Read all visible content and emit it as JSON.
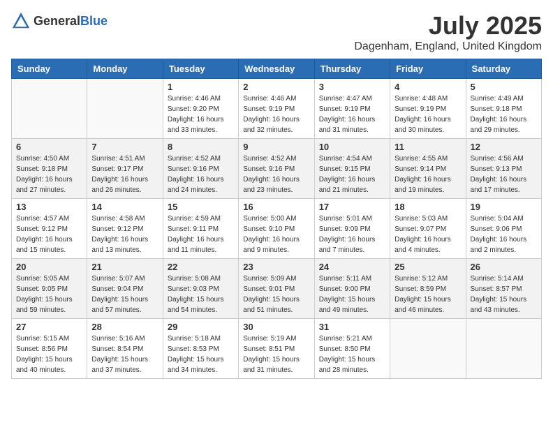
{
  "header": {
    "logo_general": "General",
    "logo_blue": "Blue",
    "month": "July 2025",
    "location": "Dagenham, England, United Kingdom"
  },
  "days_of_week": [
    "Sunday",
    "Monday",
    "Tuesday",
    "Wednesday",
    "Thursday",
    "Friday",
    "Saturday"
  ],
  "weeks": [
    {
      "shaded": false,
      "days": [
        {
          "num": "",
          "sunrise": "",
          "sunset": "",
          "daylight": ""
        },
        {
          "num": "",
          "sunrise": "",
          "sunset": "",
          "daylight": ""
        },
        {
          "num": "1",
          "sunrise": "Sunrise: 4:46 AM",
          "sunset": "Sunset: 9:20 PM",
          "daylight": "Daylight: 16 hours and 33 minutes."
        },
        {
          "num": "2",
          "sunrise": "Sunrise: 4:46 AM",
          "sunset": "Sunset: 9:19 PM",
          "daylight": "Daylight: 16 hours and 32 minutes."
        },
        {
          "num": "3",
          "sunrise": "Sunrise: 4:47 AM",
          "sunset": "Sunset: 9:19 PM",
          "daylight": "Daylight: 16 hours and 31 minutes."
        },
        {
          "num": "4",
          "sunrise": "Sunrise: 4:48 AM",
          "sunset": "Sunset: 9:19 PM",
          "daylight": "Daylight: 16 hours and 30 minutes."
        },
        {
          "num": "5",
          "sunrise": "Sunrise: 4:49 AM",
          "sunset": "Sunset: 9:18 PM",
          "daylight": "Daylight: 16 hours and 29 minutes."
        }
      ]
    },
    {
      "shaded": true,
      "days": [
        {
          "num": "6",
          "sunrise": "Sunrise: 4:50 AM",
          "sunset": "Sunset: 9:18 PM",
          "daylight": "Daylight: 16 hours and 27 minutes."
        },
        {
          "num": "7",
          "sunrise": "Sunrise: 4:51 AM",
          "sunset": "Sunset: 9:17 PM",
          "daylight": "Daylight: 16 hours and 26 minutes."
        },
        {
          "num": "8",
          "sunrise": "Sunrise: 4:52 AM",
          "sunset": "Sunset: 9:16 PM",
          "daylight": "Daylight: 16 hours and 24 minutes."
        },
        {
          "num": "9",
          "sunrise": "Sunrise: 4:52 AM",
          "sunset": "Sunset: 9:16 PM",
          "daylight": "Daylight: 16 hours and 23 minutes."
        },
        {
          "num": "10",
          "sunrise": "Sunrise: 4:54 AM",
          "sunset": "Sunset: 9:15 PM",
          "daylight": "Daylight: 16 hours and 21 minutes."
        },
        {
          "num": "11",
          "sunrise": "Sunrise: 4:55 AM",
          "sunset": "Sunset: 9:14 PM",
          "daylight": "Daylight: 16 hours and 19 minutes."
        },
        {
          "num": "12",
          "sunrise": "Sunrise: 4:56 AM",
          "sunset": "Sunset: 9:13 PM",
          "daylight": "Daylight: 16 hours and 17 minutes."
        }
      ]
    },
    {
      "shaded": false,
      "days": [
        {
          "num": "13",
          "sunrise": "Sunrise: 4:57 AM",
          "sunset": "Sunset: 9:12 PM",
          "daylight": "Daylight: 16 hours and 15 minutes."
        },
        {
          "num": "14",
          "sunrise": "Sunrise: 4:58 AM",
          "sunset": "Sunset: 9:12 PM",
          "daylight": "Daylight: 16 hours and 13 minutes."
        },
        {
          "num": "15",
          "sunrise": "Sunrise: 4:59 AM",
          "sunset": "Sunset: 9:11 PM",
          "daylight": "Daylight: 16 hours and 11 minutes."
        },
        {
          "num": "16",
          "sunrise": "Sunrise: 5:00 AM",
          "sunset": "Sunset: 9:10 PM",
          "daylight": "Daylight: 16 hours and 9 minutes."
        },
        {
          "num": "17",
          "sunrise": "Sunrise: 5:01 AM",
          "sunset": "Sunset: 9:09 PM",
          "daylight": "Daylight: 16 hours and 7 minutes."
        },
        {
          "num": "18",
          "sunrise": "Sunrise: 5:03 AM",
          "sunset": "Sunset: 9:07 PM",
          "daylight": "Daylight: 16 hours and 4 minutes."
        },
        {
          "num": "19",
          "sunrise": "Sunrise: 5:04 AM",
          "sunset": "Sunset: 9:06 PM",
          "daylight": "Daylight: 16 hours and 2 minutes."
        }
      ]
    },
    {
      "shaded": true,
      "days": [
        {
          "num": "20",
          "sunrise": "Sunrise: 5:05 AM",
          "sunset": "Sunset: 9:05 PM",
          "daylight": "Daylight: 15 hours and 59 minutes."
        },
        {
          "num": "21",
          "sunrise": "Sunrise: 5:07 AM",
          "sunset": "Sunset: 9:04 PM",
          "daylight": "Daylight: 15 hours and 57 minutes."
        },
        {
          "num": "22",
          "sunrise": "Sunrise: 5:08 AM",
          "sunset": "Sunset: 9:03 PM",
          "daylight": "Daylight: 15 hours and 54 minutes."
        },
        {
          "num": "23",
          "sunrise": "Sunrise: 5:09 AM",
          "sunset": "Sunset: 9:01 PM",
          "daylight": "Daylight: 15 hours and 51 minutes."
        },
        {
          "num": "24",
          "sunrise": "Sunrise: 5:11 AM",
          "sunset": "Sunset: 9:00 PM",
          "daylight": "Daylight: 15 hours and 49 minutes."
        },
        {
          "num": "25",
          "sunrise": "Sunrise: 5:12 AM",
          "sunset": "Sunset: 8:59 PM",
          "daylight": "Daylight: 15 hours and 46 minutes."
        },
        {
          "num": "26",
          "sunrise": "Sunrise: 5:14 AM",
          "sunset": "Sunset: 8:57 PM",
          "daylight": "Daylight: 15 hours and 43 minutes."
        }
      ]
    },
    {
      "shaded": false,
      "days": [
        {
          "num": "27",
          "sunrise": "Sunrise: 5:15 AM",
          "sunset": "Sunset: 8:56 PM",
          "daylight": "Daylight: 15 hours and 40 minutes."
        },
        {
          "num": "28",
          "sunrise": "Sunrise: 5:16 AM",
          "sunset": "Sunset: 8:54 PM",
          "daylight": "Daylight: 15 hours and 37 minutes."
        },
        {
          "num": "29",
          "sunrise": "Sunrise: 5:18 AM",
          "sunset": "Sunset: 8:53 PM",
          "daylight": "Daylight: 15 hours and 34 minutes."
        },
        {
          "num": "30",
          "sunrise": "Sunrise: 5:19 AM",
          "sunset": "Sunset: 8:51 PM",
          "daylight": "Daylight: 15 hours and 31 minutes."
        },
        {
          "num": "31",
          "sunrise": "Sunrise: 5:21 AM",
          "sunset": "Sunset: 8:50 PM",
          "daylight": "Daylight: 15 hours and 28 minutes."
        },
        {
          "num": "",
          "sunrise": "",
          "sunset": "",
          "daylight": ""
        },
        {
          "num": "",
          "sunrise": "",
          "sunset": "",
          "daylight": ""
        }
      ]
    }
  ]
}
